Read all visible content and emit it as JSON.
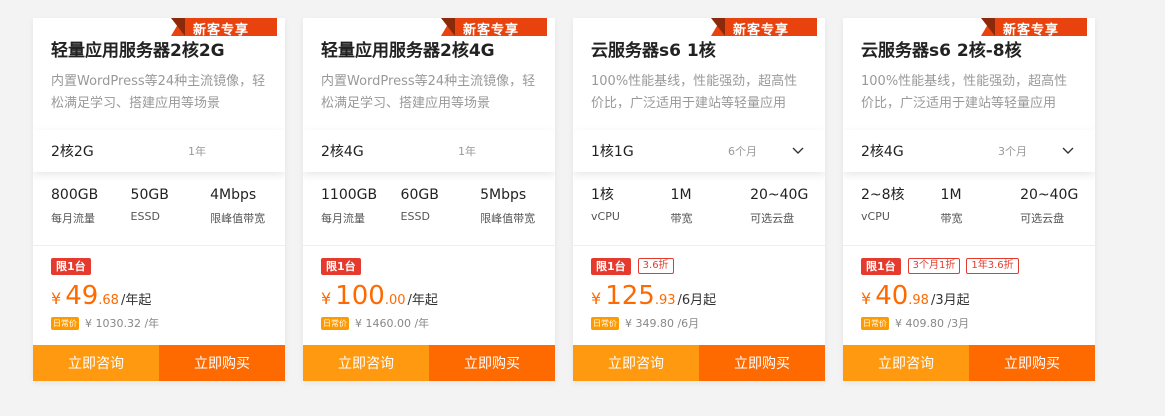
{
  "ribbon_label": "新客专享",
  "actions": {
    "consult": "立即咨询",
    "buy": "立即购买"
  },
  "orig_badge": "日常价",
  "colors": {
    "accent": "#ff6a00",
    "ribbon": "#e8430e",
    "tag": "#e43b2e",
    "consult": "#ff9a10"
  },
  "cards": [
    {
      "title": "轻量应用服务器2核2G",
      "desc": "内置WordPress等24种主流镜像，轻松满足学习、搭建应用等场景",
      "spec": "2核2G",
      "term": "1年",
      "has_dropdown": false,
      "features": [
        {
          "value": "800GB",
          "label": "每月流量"
        },
        {
          "value": "50GB",
          "label": "ESSD"
        },
        {
          "value": "4Mbps",
          "label": "限峰值带宽"
        }
      ],
      "tag": "限1台",
      "extra_tags": [],
      "price_symbol": "¥",
      "price_int": "49",
      "price_dec": ".68",
      "price_unit": "/年起",
      "orig_price": "¥ 1030.32 /年"
    },
    {
      "title": "轻量应用服务器2核4G",
      "desc": "内置WordPress等24种主流镜像，轻松满足学习、搭建应用等场景",
      "spec": "2核4G",
      "term": "1年",
      "has_dropdown": false,
      "features": [
        {
          "value": "1100GB",
          "label": "每月流量"
        },
        {
          "value": "60GB",
          "label": "ESSD"
        },
        {
          "value": "5Mbps",
          "label": "限峰值带宽"
        }
      ],
      "tag": "限1台",
      "extra_tags": [],
      "price_symbol": "¥",
      "price_int": "100",
      "price_dec": ".00",
      "price_unit": "/年起",
      "orig_price": "¥ 1460.00 /年"
    },
    {
      "title": "云服务器s6 1核",
      "desc": "100%性能基线，性能强劲，超高性价比，广泛适用于建站等轻量应用",
      "spec": "1核1G",
      "term": "6个月",
      "has_dropdown": true,
      "features": [
        {
          "value": "1核",
          "label": "vCPU"
        },
        {
          "value": "1M",
          "label": "带宽"
        },
        {
          "value": "20~40G",
          "label": "可选云盘"
        }
      ],
      "tag": "限1台",
      "extra_tags": [
        "3.6折"
      ],
      "price_symbol": "¥",
      "price_int": "125",
      "price_dec": ".93",
      "price_unit": "/6月起",
      "orig_price": "¥ 349.80 /6月"
    },
    {
      "title": "云服务器s6 2核-8核",
      "desc": "100%性能基线，性能强劲，超高性价比，广泛适用于建站等轻量应用",
      "spec": "2核4G",
      "term": "3个月",
      "has_dropdown": true,
      "features": [
        {
          "value": "2~8核",
          "label": "vCPU"
        },
        {
          "value": "1M",
          "label": "带宽"
        },
        {
          "value": "20~40G",
          "label": "可选云盘"
        }
      ],
      "tag": "限1台",
      "extra_tags": [
        "3个月1折",
        "1年3.6折"
      ],
      "price_symbol": "¥",
      "price_int": "40",
      "price_dec": ".98",
      "price_unit": "/3月起",
      "orig_price": "¥ 409.80 /3月"
    }
  ]
}
